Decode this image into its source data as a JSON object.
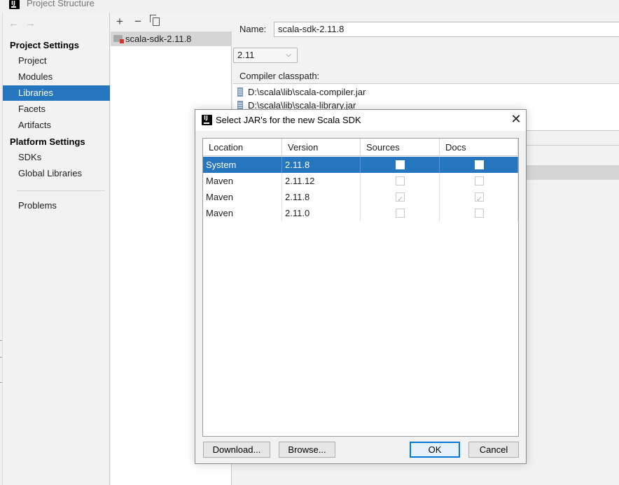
{
  "window": {
    "title": "Project Structure",
    "icon": "intellij-app-icon"
  },
  "nav": {
    "back": "←",
    "forward": "→"
  },
  "sidebar": {
    "project_settings_title": "Project Settings",
    "project_items": [
      {
        "label": "Project"
      },
      {
        "label": "Modules"
      },
      {
        "label": "Libraries",
        "selected": true
      },
      {
        "label": "Facets"
      },
      {
        "label": "Artifacts"
      }
    ],
    "platform_settings_title": "Platform Settings",
    "platform_items": [
      {
        "label": "SDKs"
      },
      {
        "label": "Global Libraries"
      }
    ],
    "problems_label": "Problems"
  },
  "library_panel": {
    "toolbar": {
      "add": "+",
      "remove": "−",
      "copy": "copy-icon"
    },
    "libraries": [
      {
        "name": "scala-sdk-2.11.8",
        "selected": true
      }
    ]
  },
  "detail": {
    "name_label": "Name:",
    "name_value": "scala-sdk-2.11.8",
    "version_selected": "2.11",
    "compiler_classpath_label": "Compiler classpath:",
    "classpath": [
      "D:\\scala\\lib\\scala-compiler.jar",
      "D:\\scala\\lib\\scala-library.jar"
    ]
  },
  "dialog": {
    "title": "Select JAR's for the new Scala SDK",
    "columns": [
      "Location",
      "Version",
      "Sources",
      "Docs"
    ],
    "rows": [
      {
        "location": "System",
        "version": "2.11.8",
        "sources": false,
        "docs": false,
        "selected": true
      },
      {
        "location": "Maven",
        "version": "2.11.12",
        "sources": false,
        "docs": false,
        "selected": false
      },
      {
        "location": "Maven",
        "version": "2.11.8",
        "sources": true,
        "docs": true,
        "selected": false
      },
      {
        "location": "Maven",
        "version": "2.11.0",
        "sources": false,
        "docs": false,
        "selected": false
      }
    ],
    "buttons": {
      "download": "Download...",
      "browse": "Browse...",
      "ok": "OK",
      "cancel": "Cancel"
    }
  },
  "colors": {
    "selection": "#2675bf",
    "default_button_border": "#0078d7"
  }
}
